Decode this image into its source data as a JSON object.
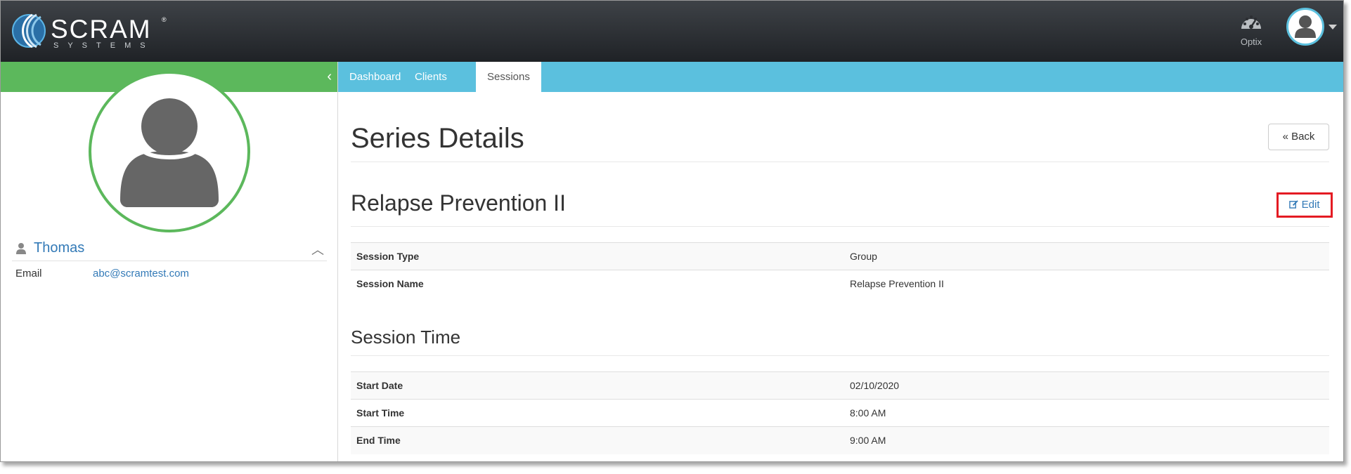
{
  "header": {
    "logo_word": "SCRAM",
    "logo_sub": "SYSTEMS",
    "logo_mark": "®",
    "optix_label": "Optix",
    "optix_icon": "gauge-icon",
    "user_icon": "user-avatar-icon"
  },
  "sidebar": {
    "collapse_icon": "chevron-left-icon",
    "client_name": "Thomas",
    "email_label": "Email",
    "email_value": "abc@scramtest.com"
  },
  "tabs": [
    {
      "label": "Dashboard",
      "active": false
    },
    {
      "label": "Clients",
      "active": false
    },
    {
      "label": "Sessions",
      "active": true
    }
  ],
  "main": {
    "page_title": "Series Details",
    "back_label": "Back",
    "series_name": "Relapse Prevention II",
    "edit_label": "Edit",
    "session_info": [
      {
        "label": "Session Type",
        "value": "Group"
      },
      {
        "label": "Session Name",
        "value": "Relapse Prevention II"
      }
    ],
    "time_section_title": "Session Time",
    "session_time": [
      {
        "label": "Start Date",
        "value": "02/10/2020"
      },
      {
        "label": "Start Time",
        "value": "8:00 AM"
      },
      {
        "label": "End Time",
        "value": "9:00 AM"
      }
    ]
  },
  "colors": {
    "sidebar_accent": "#5cb85c",
    "tabbar": "#5bc0de",
    "link": "#337ab7",
    "highlight": "#e41b23"
  }
}
